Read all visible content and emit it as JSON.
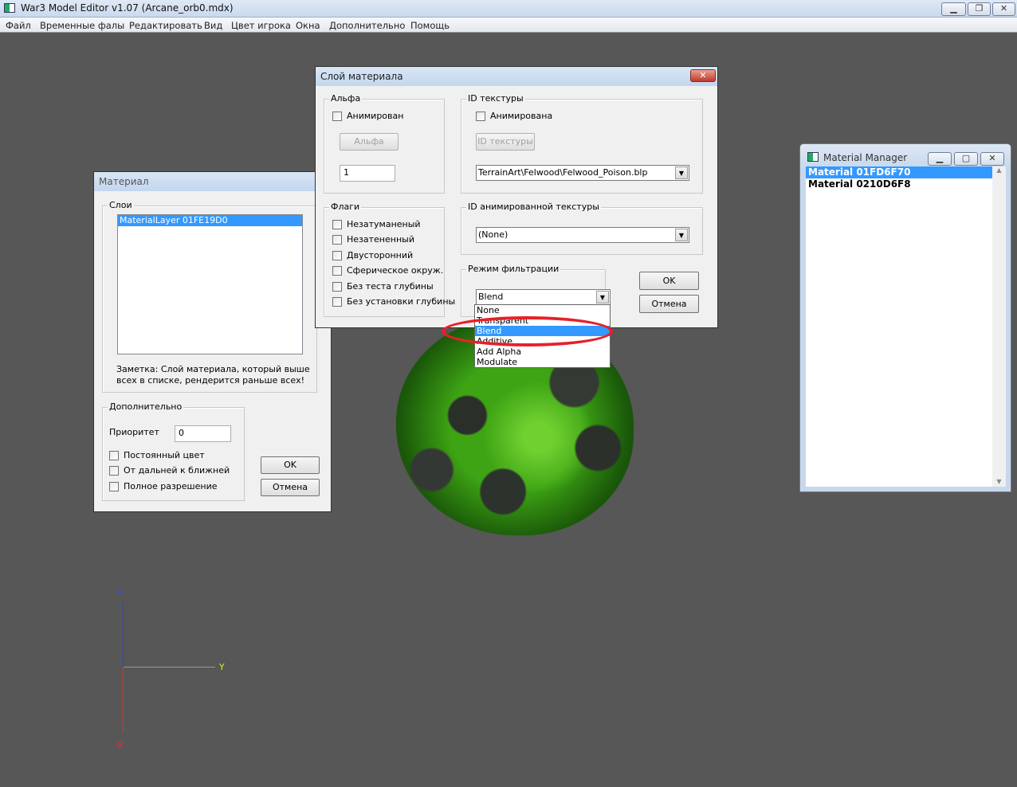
{
  "app": {
    "title": "War3 Model Editor v1.07 (Arcane_orb0.mdx)",
    "window_buttons": [
      "minimize",
      "restore",
      "close"
    ]
  },
  "menu": [
    "Файл",
    "Временные фалы",
    "Редактировать",
    "Вид",
    "Цвет игрока",
    "Окна",
    "Дополнительно",
    "Помощь"
  ],
  "material_dialog": {
    "title": "Материал",
    "layers_group": "Слои",
    "layers": [
      "MaterialLayer 01FE19D0"
    ],
    "note_line1": "Заметка: Слой материала, который выше",
    "note_line2": "всех в списке, рендерится раньше всех!",
    "extra_group": "Дополнительно",
    "priority_label": "Приоритет",
    "priority_value": "0",
    "checkboxes": [
      "Постоянный цвет",
      "От дальней к ближней",
      "Полное разрешение"
    ],
    "ok": "OK",
    "cancel": "Отмена"
  },
  "layer_dialog": {
    "title": "Слой материала",
    "alpha_group": "Альфа",
    "alpha_animated": "Анимирован",
    "alpha_button": "Альфа",
    "alpha_value": "1",
    "flags_group": "Флаги",
    "flags": [
      "Незатуманеный",
      "Незатененный",
      "Двусторонний",
      "Сферическое окруж.",
      "Без теста глубины",
      "Без установки глубины"
    ],
    "texture_group": "ID текстуры",
    "texture_animated": "Анимирована",
    "texture_button": "ID текстуры",
    "texture_value": "TerrainArt\\Felwood\\Felwood_Poison.blp",
    "anim_texture_group": "ID анимированной текстуры",
    "anim_texture_value": "(None)",
    "filter_group": "Режим фильтрации",
    "filter_value": "Blend",
    "filter_options": [
      "None",
      "Transparent",
      "Blend",
      "Additive",
      "Add Alpha",
      "Modulate"
    ],
    "filter_selected_index": 2,
    "ok": "OK",
    "cancel": "Отмена"
  },
  "material_manager": {
    "title": "Material Manager",
    "items": [
      "Material 01FD6F70",
      "Material 0210D6F8"
    ],
    "selected_index": 0
  },
  "axes": {
    "z": "Z",
    "y": "Y",
    "x": "X"
  },
  "colors": {
    "selection": "#3399ff",
    "viewport": "#575757",
    "highlight_ellipse": "#e8202a"
  }
}
